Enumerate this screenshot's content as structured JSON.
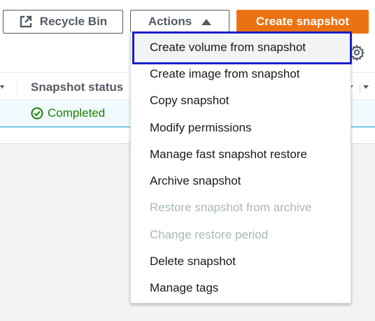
{
  "toolbar": {
    "recycle_bin_label": "Recycle Bin",
    "actions_label": "Actions",
    "create_snapshot_label": "Create snapshot"
  },
  "table": {
    "columns": [
      "Snapshot status"
    ],
    "rows": [
      {
        "status": "Completed"
      }
    ]
  },
  "actions_menu": {
    "items": [
      {
        "label": "Create volume from snapshot",
        "disabled": false,
        "highlighted": true
      },
      {
        "label": "Create image from snapshot",
        "disabled": false
      },
      {
        "label": "Copy snapshot",
        "disabled": false
      },
      {
        "label": "Modify permissions",
        "disabled": false
      },
      {
        "label": "Manage fast snapshot restore",
        "disabled": false
      },
      {
        "label": "Archive snapshot",
        "disabled": false
      },
      {
        "label": "Restore snapshot from archive",
        "disabled": true
      },
      {
        "label": "Change restore period",
        "disabled": true
      },
      {
        "label": "Delete snapshot",
        "disabled": false
      },
      {
        "label": "Manage tags",
        "disabled": false
      }
    ]
  },
  "colors": {
    "primary": "#ec7211",
    "success": "#1d8102",
    "focus": "#1a1ec8",
    "disabled": "#aab7b8"
  },
  "icons": {
    "recycle_bin": "external-link-icon",
    "actions_caret": "caret-up-icon",
    "settings": "gear-icon",
    "status": "check-circle-icon"
  }
}
